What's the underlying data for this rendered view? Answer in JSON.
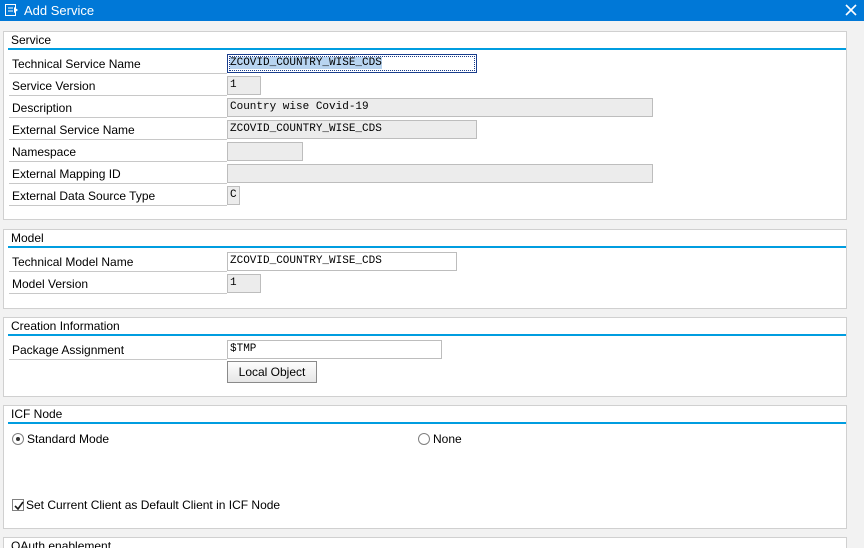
{
  "window": {
    "title": "Add Service",
    "icon": "add-service-icon",
    "close_icon": "close-icon"
  },
  "service": {
    "title": "Service",
    "technical_service_name": {
      "label": "Technical Service Name",
      "value": "ZCOVID_COUNTRY_WISE_CDS"
    },
    "service_version": {
      "label": "Service Version",
      "value": "1"
    },
    "description": {
      "label": "Description",
      "value": "Country wise Covid-19"
    },
    "external_service_name": {
      "label": "External Service Name",
      "value": "ZCOVID_COUNTRY_WISE_CDS"
    },
    "namespace": {
      "label": "Namespace",
      "value": ""
    },
    "external_mapping_id": {
      "label": "External Mapping ID",
      "value": ""
    },
    "external_data_source_type": {
      "label": "External Data Source Type",
      "value": "C"
    }
  },
  "model": {
    "title": "Model",
    "technical_model_name": {
      "label": "Technical Model Name",
      "value": "ZCOVID_COUNTRY_WISE_CDS"
    },
    "model_version": {
      "label": "Model Version",
      "value": "1"
    }
  },
  "creation": {
    "title": "Creation Information",
    "package_assignment": {
      "label": "Package Assignment",
      "value": "$TMP"
    },
    "local_object_button": "Local Object"
  },
  "icf": {
    "title": "ICF Node",
    "standard_mode": {
      "label": "Standard Mode",
      "selected": true
    },
    "none": {
      "label": "None",
      "selected": false
    },
    "set_default_client": {
      "label": "Set Current Client as Default Client in ICF Node",
      "checked": true
    }
  },
  "oauth": {
    "title": "OAuth enablement"
  }
}
